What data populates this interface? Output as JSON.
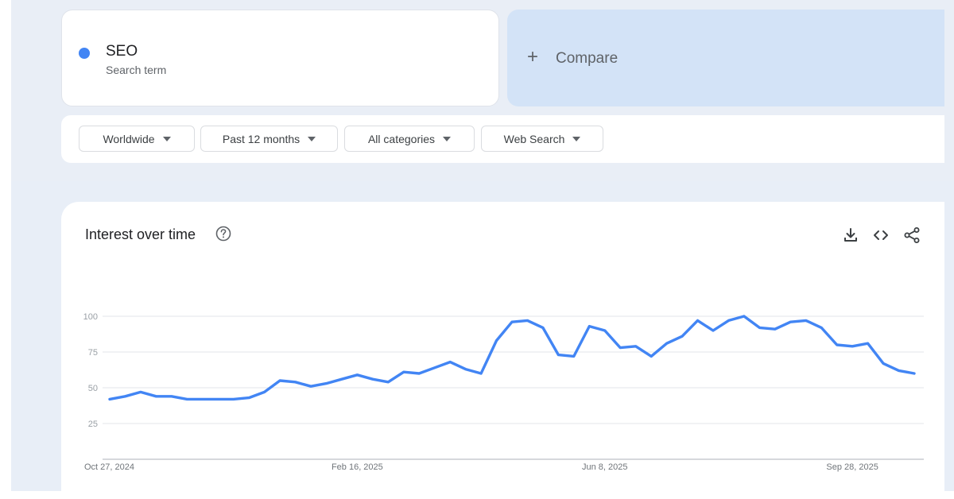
{
  "search_term": {
    "name": "SEO",
    "subtitle": "Search term",
    "color": "#4285f4"
  },
  "compare": {
    "label": "Compare",
    "icon": "plus-icon"
  },
  "filters": [
    {
      "label": "Worldwide",
      "icon": "caret-down-icon"
    },
    {
      "label": "Past 12 months",
      "icon": "caret-down-icon"
    },
    {
      "label": "All categories",
      "icon": "caret-down-icon"
    },
    {
      "label": "Web Search",
      "icon": "caret-down-icon"
    }
  ],
  "panel": {
    "title": "Interest over time",
    "help_icon": "help-circle-icon",
    "actions": [
      "download-icon",
      "embed-code-icon",
      "share-icon"
    ]
  },
  "chart_data": {
    "type": "line",
    "title": "Interest over time",
    "xlabel": "",
    "ylabel": "",
    "ylim": [
      0,
      100
    ],
    "yticks": [
      25,
      50,
      75,
      100
    ],
    "grid": true,
    "x_tick_labels": [
      "Oct 27, 2024",
      "Feb 16, 2025",
      "Jun 8, 2025",
      "Sep 28, 2025"
    ],
    "series": [
      {
        "name": "SEO",
        "color": "#4285f4",
        "values": [
          42,
          44,
          47,
          44,
          44,
          42,
          42,
          42,
          42,
          43,
          47,
          55,
          54,
          51,
          53,
          56,
          59,
          56,
          54,
          61,
          60,
          64,
          68,
          63,
          60,
          83,
          96,
          97,
          92,
          73,
          72,
          93,
          90,
          78,
          79,
          72,
          81,
          86,
          97,
          90,
          97,
          100,
          92,
          91,
          96,
          97,
          92,
          80,
          79,
          81,
          67,
          62,
          60
        ]
      }
    ]
  }
}
